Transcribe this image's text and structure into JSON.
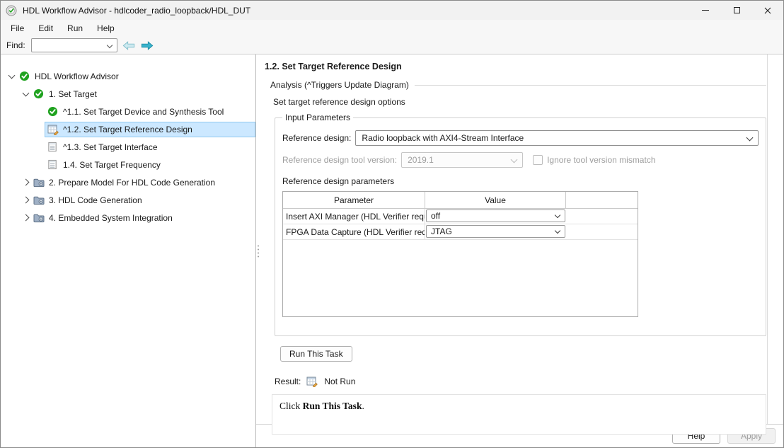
{
  "window": {
    "title": "HDL Workflow Advisor - hdlcoder_radio_loopback/HDL_DUT"
  },
  "menubar": {
    "items": [
      "File",
      "Edit",
      "Run",
      "Help"
    ]
  },
  "findbar": {
    "label": "Find:",
    "value": ""
  },
  "tree": {
    "items": [
      {
        "label": "HDL Workflow Advisor",
        "depth": 0,
        "icon": "check",
        "expander": "expanded",
        "selected": false
      },
      {
        "label": "1. Set Target",
        "depth": 1,
        "icon": "check",
        "expander": "expanded",
        "selected": false
      },
      {
        "label": "^1.1. Set Target Device and Synthesis Tool",
        "depth": 2,
        "icon": "check",
        "expander": "none",
        "selected": false
      },
      {
        "label": "^1.2. Set Target Reference Design",
        "depth": 2,
        "icon": "task",
        "expander": "none",
        "selected": true
      },
      {
        "label": "^1.3. Set Target Interface",
        "depth": 2,
        "icon": "doc",
        "expander": "none",
        "selected": false
      },
      {
        "label": "1.4. Set Target Frequency",
        "depth": 2,
        "icon": "doc",
        "expander": "none",
        "selected": false
      },
      {
        "label": "2. Prepare Model For HDL Code Generation",
        "depth": 1,
        "icon": "folder",
        "expander": "collapsed",
        "selected": false
      },
      {
        "label": "3. HDL Code Generation",
        "depth": 1,
        "icon": "folder",
        "expander": "collapsed",
        "selected": false
      },
      {
        "label": "4. Embedded System Integration",
        "depth": 1,
        "icon": "folder",
        "expander": "collapsed",
        "selected": false
      }
    ]
  },
  "panel": {
    "title": "1.2. Set Target Reference Design",
    "analysis_label": "Analysis (^Triggers Update Diagram)",
    "subtitle": "Set target reference design options",
    "input_parameters": {
      "legend": "Input Parameters",
      "reference_design": {
        "label": "Reference design:",
        "value": "Radio loopback with AXI4-Stream Interface"
      },
      "tool_version": {
        "label": "Reference design tool version:",
        "value": "2019.1",
        "checkbox_label": "Ignore tool version mismatch",
        "checked": false
      },
      "params_label": "Reference design parameters",
      "table": {
        "columns": [
          "Parameter",
          "Value"
        ],
        "rows": [
          {
            "parameter": "Insert AXI Manager (HDL Verifier requ...",
            "value": "off"
          },
          {
            "parameter": "FPGA Data Capture (HDL Verifier req...",
            "value": "JTAG"
          }
        ]
      }
    },
    "run_button": "Run This Task",
    "result": {
      "label": "Result:",
      "status": "Not Run",
      "message_prefix": "Click ",
      "message_bold": "Run This Task",
      "message_suffix": "."
    },
    "footer": {
      "help": "Help",
      "apply": "Apply"
    },
    "accent_colors": {
      "selection": "#cce8ff",
      "check_green": "#1fa21f",
      "arrow_teal": "#39b3cc"
    }
  }
}
